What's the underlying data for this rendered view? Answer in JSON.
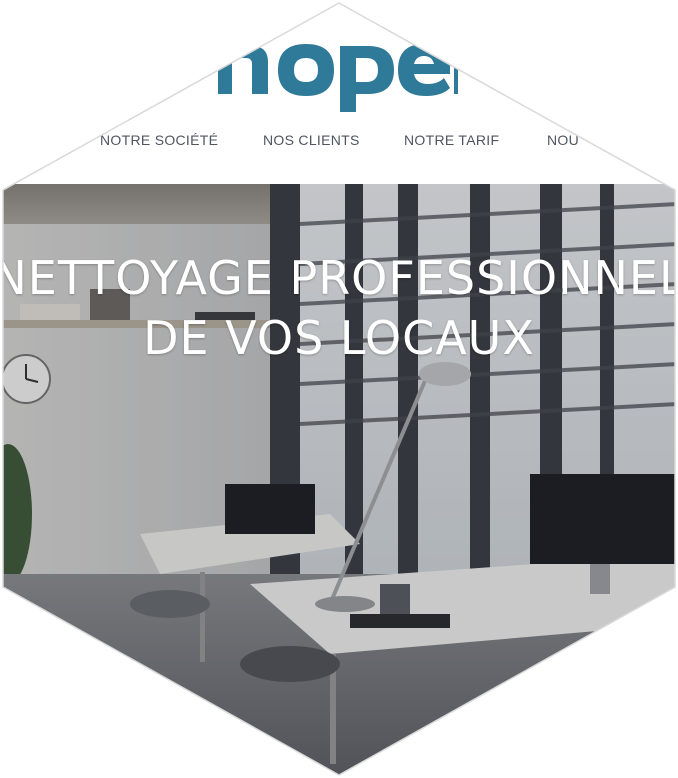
{
  "brand": {
    "logo_text": "nopen",
    "logo_color": "#2f7a98"
  },
  "nav": {
    "items": [
      {
        "label": "NOTRE SOCIÉTÉ"
      },
      {
        "label": "NOS CLIENTS"
      },
      {
        "label": "NOTRE TARIF"
      },
      {
        "label": "NOU"
      }
    ]
  },
  "hero": {
    "line1": "NETTOYAGE PROFESSIONNEL",
    "line2": "DE VOS LOCAUX"
  },
  "colors": {
    "nav_text": "#4f5560",
    "hero_text": "#ffffff"
  }
}
